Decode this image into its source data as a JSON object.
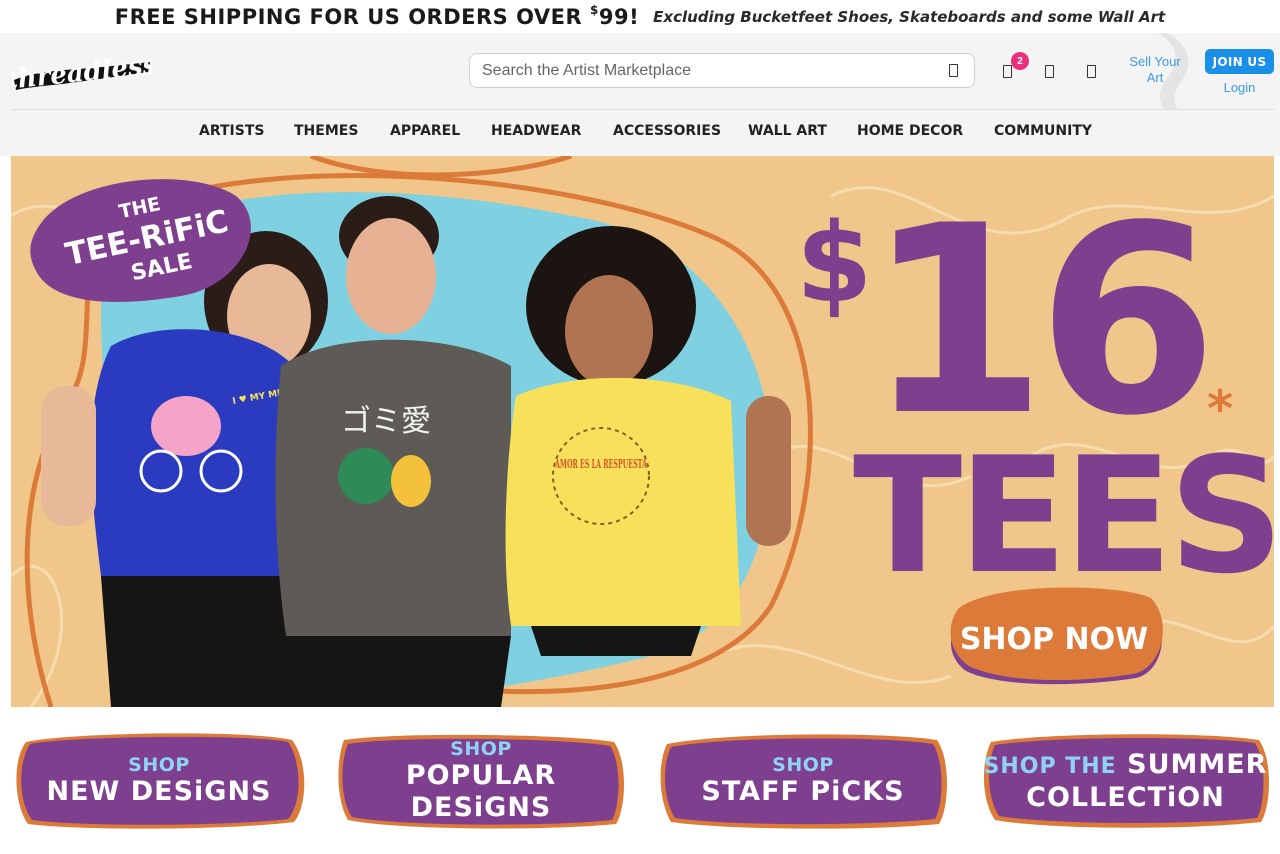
{
  "promo": {
    "main_prefix": "FREE SHIPPING FOR US ORDERS OVER ",
    "currency": "$",
    "amount": "99!",
    "sub": "Excluding Bucketfeet Shoes, Skateboards and some Wall Art"
  },
  "header": {
    "logo_text": "threadless",
    "search": {
      "placeholder": "Search the Artist Marketplace"
    },
    "cart_count": "2",
    "sell_label": "Sell Your Art",
    "join_label": "JOIN US",
    "login_label": "Login"
  },
  "nav": {
    "items": [
      "ARTISTS",
      "THEMES",
      "APPAREL",
      "HEADWEAR",
      "ACCESSORIES",
      "WALL ART",
      "HOME DECOR",
      "COMMUNITY"
    ]
  },
  "hero": {
    "sale_line1": "THE",
    "sale_line2": "TEE-RiFiC",
    "sale_line3": "SALE",
    "price": "$16",
    "price_symbol": "$",
    "price_value": "16",
    "asterisk": "*",
    "tees": "TEES",
    "cta": "SHOP NOW",
    "shirt1_text": "I ♥ MY MENSTRUAL CYCLE!",
    "shirt2_text": "ゴミ愛",
    "shirt3_text": "AMOR ES LA RESPUESTA",
    "colors": {
      "purple": "#7e3f8f",
      "orange": "#dc7b39",
      "sand": "#f0c68a",
      "teal": "#7fd0e0"
    }
  },
  "categories": [
    {
      "small": "SHOP",
      "big": "NEW DESiGNS"
    },
    {
      "small": "SHOP",
      "big": "POPULAR DESiGNS"
    },
    {
      "small": "SHOP",
      "big": "STAFF PiCKS"
    },
    {
      "small": "SHOP THE",
      "big": "SUMMER",
      "big2": "COLLECTiON"
    }
  ]
}
